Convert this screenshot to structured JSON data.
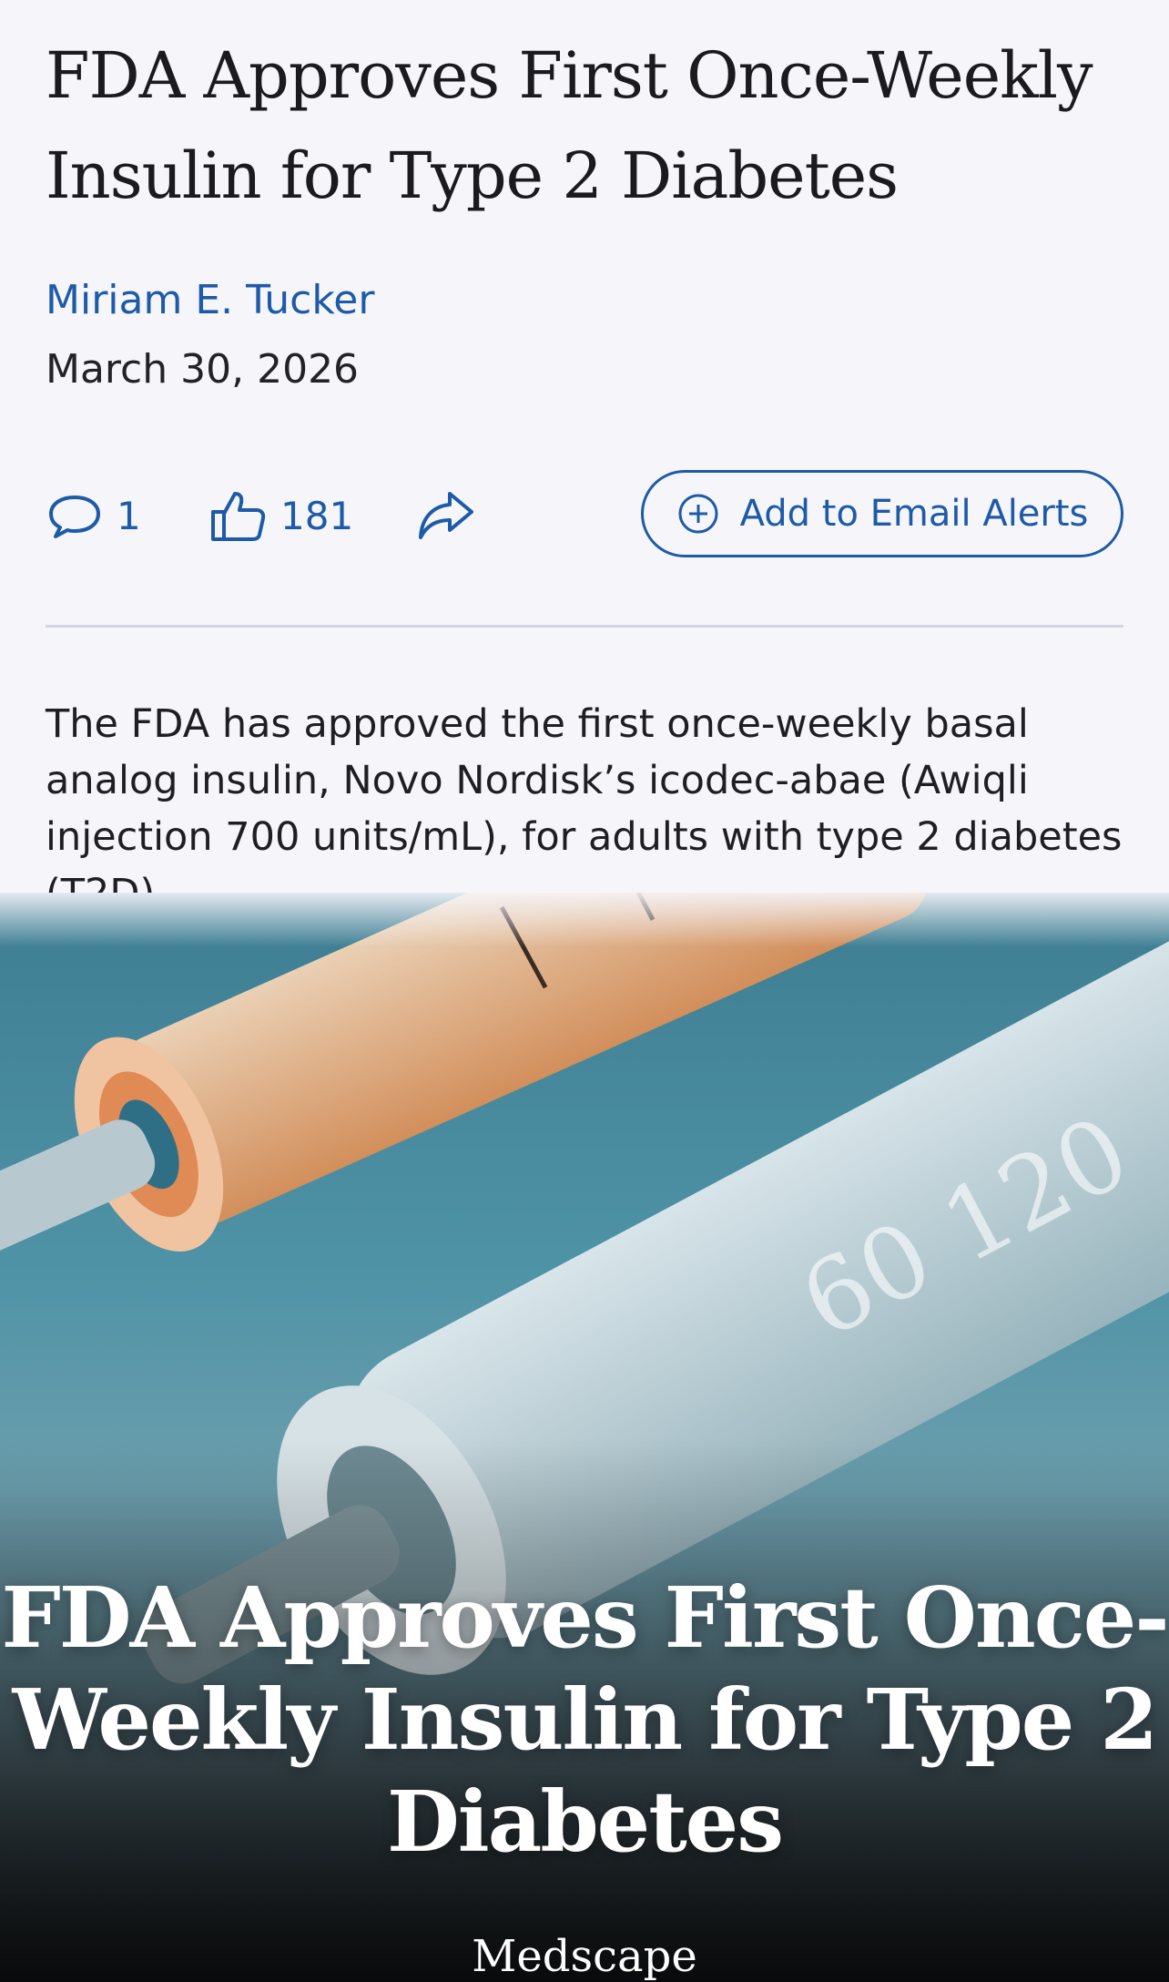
{
  "article": {
    "title": "FDA Approves First Once-Weekly Insulin for Type 2 Diabetes",
    "author": "Miriam E. Tucker",
    "date": "March 30, 2026",
    "lede": "The FDA has approved the first once-weekly basal analog insulin, Novo Nordisk’s icodec-abae (Awiqli injection 700 units/mL), for adults with type 2 diabetes (T2D)."
  },
  "actions": {
    "comments_count": "1",
    "likes_count": "181",
    "share_icon": "share-arrow-icon",
    "email_alerts_label": "Add to Email Alerts"
  },
  "hero": {
    "overlay_title": "FDA Approves First Once-Weekly Insulin for Type 2 Diabetes",
    "pen_marking": "60 120",
    "brand": "Medscape"
  },
  "colors": {
    "accent": "#1d5aa8",
    "text": "#1b1b1f",
    "background": "#f6f6fa",
    "divider": "#d3d6df"
  }
}
